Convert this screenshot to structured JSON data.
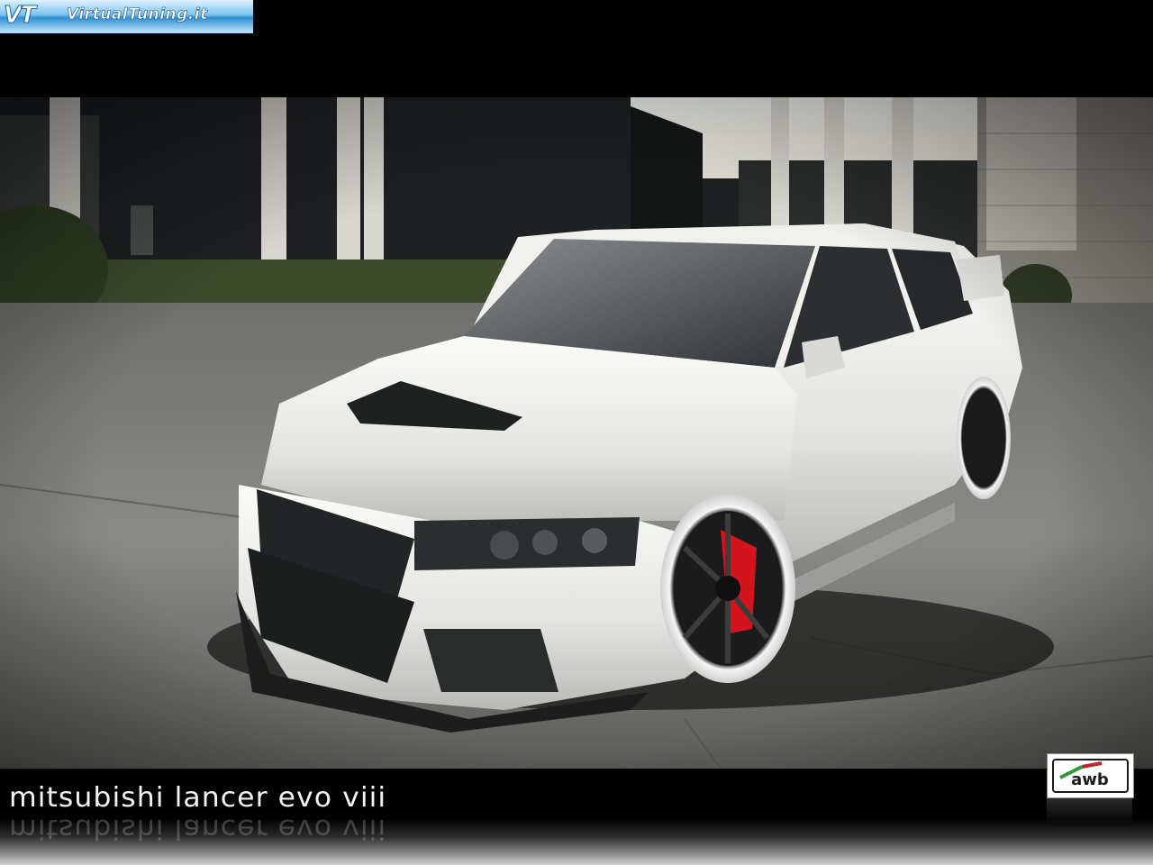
{
  "site_logo": {
    "mark": "VT",
    "text": "VirtualTuning.it"
  },
  "caption": {
    "title": "mitsubishi lancer evo viii"
  },
  "brand_badge": {
    "text": "awb"
  },
  "colors": {
    "logo_blue": "#2f8fd0",
    "car_white": "#e9e9e6",
    "brake_red": "#d3141c",
    "badge_green": "#2e9a3c",
    "badge_red": "#c0262a"
  }
}
